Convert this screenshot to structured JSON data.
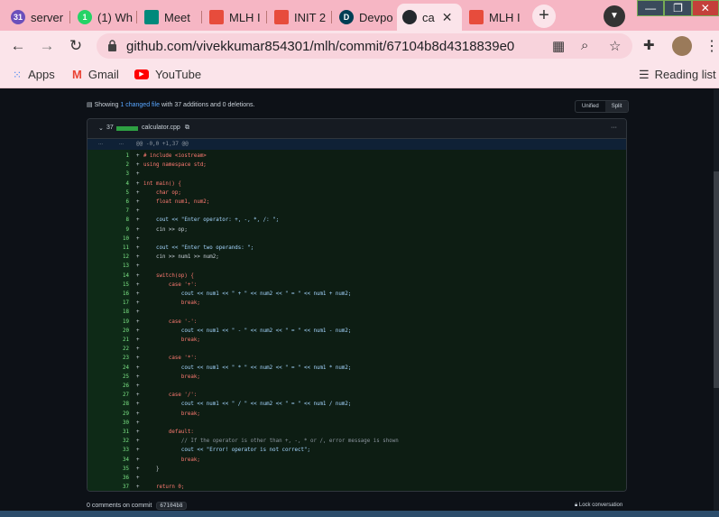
{
  "browser": {
    "tabs": [
      {
        "title": "server",
        "icon": "calendar-icon",
        "color": "#6b4fbb",
        "badge": "31"
      },
      {
        "title": "(1) Wh",
        "icon": "whatsapp-icon",
        "color": "#25d366",
        "badge": "1"
      },
      {
        "title": "Meet",
        "icon": "meet-icon",
        "color": "#00897b",
        "badge": ""
      },
      {
        "title": "MLH I",
        "icon": "mlh-icon",
        "color": "#e74c3c",
        "badge": ""
      },
      {
        "title": "INIT 2",
        "icon": "mlh-icon",
        "color": "#e74c3c",
        "badge": ""
      },
      {
        "title": "Devpo",
        "icon": "devpost-icon",
        "color": "#003e54",
        "badge": "D"
      },
      {
        "title": "ca",
        "icon": "github-icon",
        "color": "#24292e",
        "badge": ""
      },
      {
        "title": "MLH I",
        "icon": "mlh-icon",
        "color": "#e74c3c",
        "badge": ""
      }
    ],
    "new_tab": "+",
    "url_host": "github.com",
    "url_path": "/vivekkumar854301/mlh/commit/67104b8d4318839e0029c8e..."
  },
  "bookmarks": {
    "items": [
      {
        "label": "Apps"
      },
      {
        "label": "Gmail"
      },
      {
        "label": "YouTube"
      }
    ],
    "reading_list": "Reading list"
  },
  "diff": {
    "summary_prefix": "Showing",
    "summary_link": "1 changed file",
    "summary_suffix": "with 37 additions and 0 deletions.",
    "mode_unified": "Unified",
    "mode_split": "Split",
    "file_count": "37",
    "filename": "calculator.cpp",
    "more": "···",
    "hunk_old": "...",
    "hunk_new": "...",
    "hunk_header": "@@ -0,0 +1,37 @@"
  },
  "footer": {
    "comments": "0 comments on commit",
    "sha": "67104b8",
    "lock": "Lock conversation"
  },
  "colors": {
    "tabstrip": "#f6b6c4",
    "addition_bg": "#0d1d13",
    "link": "#58a6ff"
  }
}
